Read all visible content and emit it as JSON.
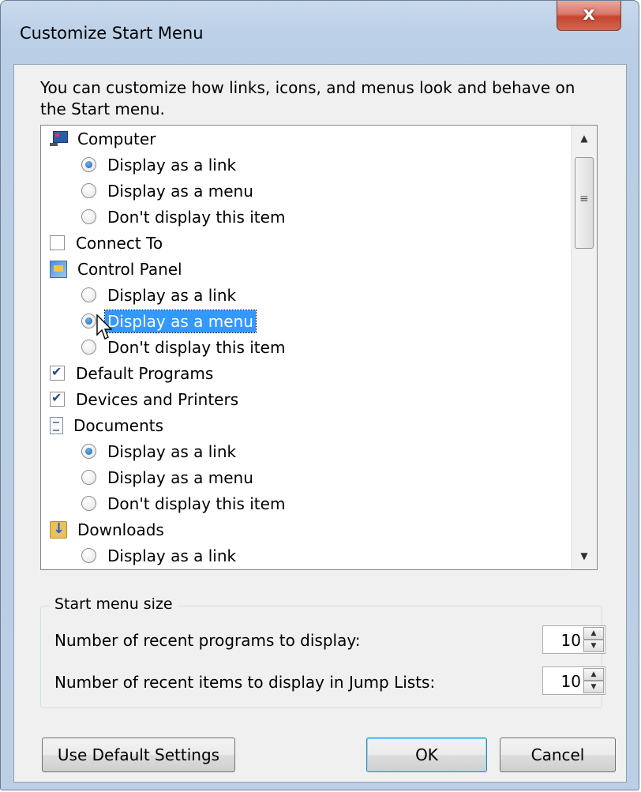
{
  "window": {
    "title": "Customize Start Menu",
    "close_glyph": "x"
  },
  "intro_text": "You can customize how links, icons, and menus look and behave on the Start menu.",
  "list": {
    "computer": {
      "label": "Computer",
      "icon": "computer-icon",
      "options": [
        "Display as a link",
        "Display as a menu",
        "Don't display this item"
      ],
      "selected": "Display as a link"
    },
    "connect_to": {
      "label": "Connect To",
      "checked": false
    },
    "control_panel": {
      "label": "Control Panel",
      "icon": "control-panel-icon",
      "options": [
        "Display as a link",
        "Display as a menu",
        "Don't display this item"
      ],
      "selected": "Display as a menu"
    },
    "default_programs": {
      "label": "Default Programs",
      "checked": true
    },
    "devices_printers": {
      "label": "Devices and Printers",
      "checked": true
    },
    "documents": {
      "label": "Documents",
      "icon": "documents-icon",
      "options": [
        "Display as a link",
        "Display as a menu",
        "Don't display this item"
      ],
      "selected": "Display as a link"
    },
    "downloads": {
      "label": "Downloads",
      "icon": "downloads-icon",
      "options": [
        "Display as a link"
      ],
      "selected": "Display as a link"
    }
  },
  "start_menu_size": {
    "legend": "Start menu size",
    "recent_programs_label": "Number of recent programs to display:",
    "recent_programs_value": "10",
    "jump_list_label": "Number of recent items to display in Jump Lists:",
    "jump_list_value": "10"
  },
  "buttons": {
    "defaults": "Use Default Settings",
    "ok": "OK",
    "cancel": "Cancel"
  },
  "colors": {
    "selection": "#3399ff",
    "window_frame": "#bcd0e7",
    "close_button": "#c7452f"
  }
}
